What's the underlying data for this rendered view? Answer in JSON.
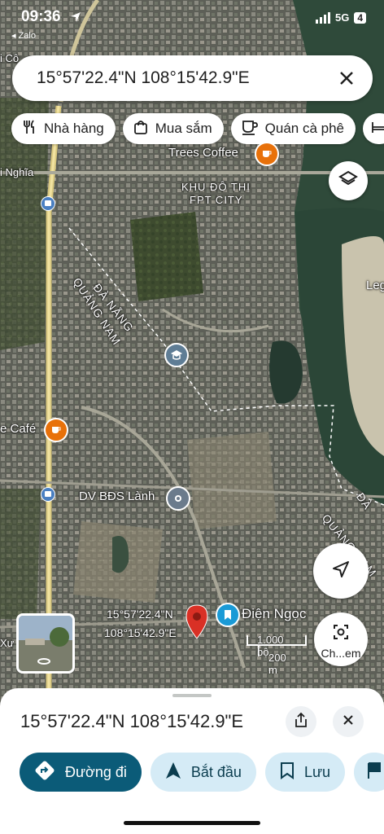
{
  "status_bar": {
    "time": "09:36",
    "back_app": "◂ Zalo",
    "network": "5G",
    "battery": "4"
  },
  "search": {
    "query": "15°57'22.4\"N 108°15'42.9\"E"
  },
  "chips": [
    {
      "label": "Nhà hàng",
      "icon": "fork-knife-icon"
    },
    {
      "label": "Mua sắm",
      "icon": "shopping-bag-icon"
    },
    {
      "label": "Quán cà phê",
      "icon": "coffee-cup-icon"
    }
  ],
  "map": {
    "labels": {
      "trees_coffee": "Trees Coffee",
      "fpt_city_line1": "KHU ĐÔ THỊ",
      "fpt_city_line2": "FPT CITY",
      "da_nang": "ĐÀ NẴNG",
      "quang_nam": "QUẢNG NAM",
      "nghia": "i Nghĩa",
      "cafe_left": "e Café",
      "dv_bds": "DV BĐS Lành",
      "dien_ngoc": "Điện Ngọc",
      "legend_right": "Leg",
      "da_right": "ĐÀ",
      "quang_nam_right": "QUẢNG NAM",
      "left_cut_top": "i Cô",
      "left_cut_bottom": "Xư",
      "pin_line1": "15°57'22.4\"N",
      "pin_line2": "108°15'42.9\"E"
    },
    "scale": {
      "feet": "1.000 bộ",
      "meters": "200 m"
    },
    "lens_label": "Ch...em"
  },
  "sheet": {
    "title": "15°57'22.4\"N 108°15'42.9\"E",
    "actions": {
      "directions": "Đường đi",
      "start": "Bắt đầu",
      "save": "Lưu"
    }
  },
  "colors": {
    "primary": "#0b5b78",
    "secondary": "#d5ebf6",
    "pin": "#d93025",
    "water": "#2f4a3a"
  }
}
